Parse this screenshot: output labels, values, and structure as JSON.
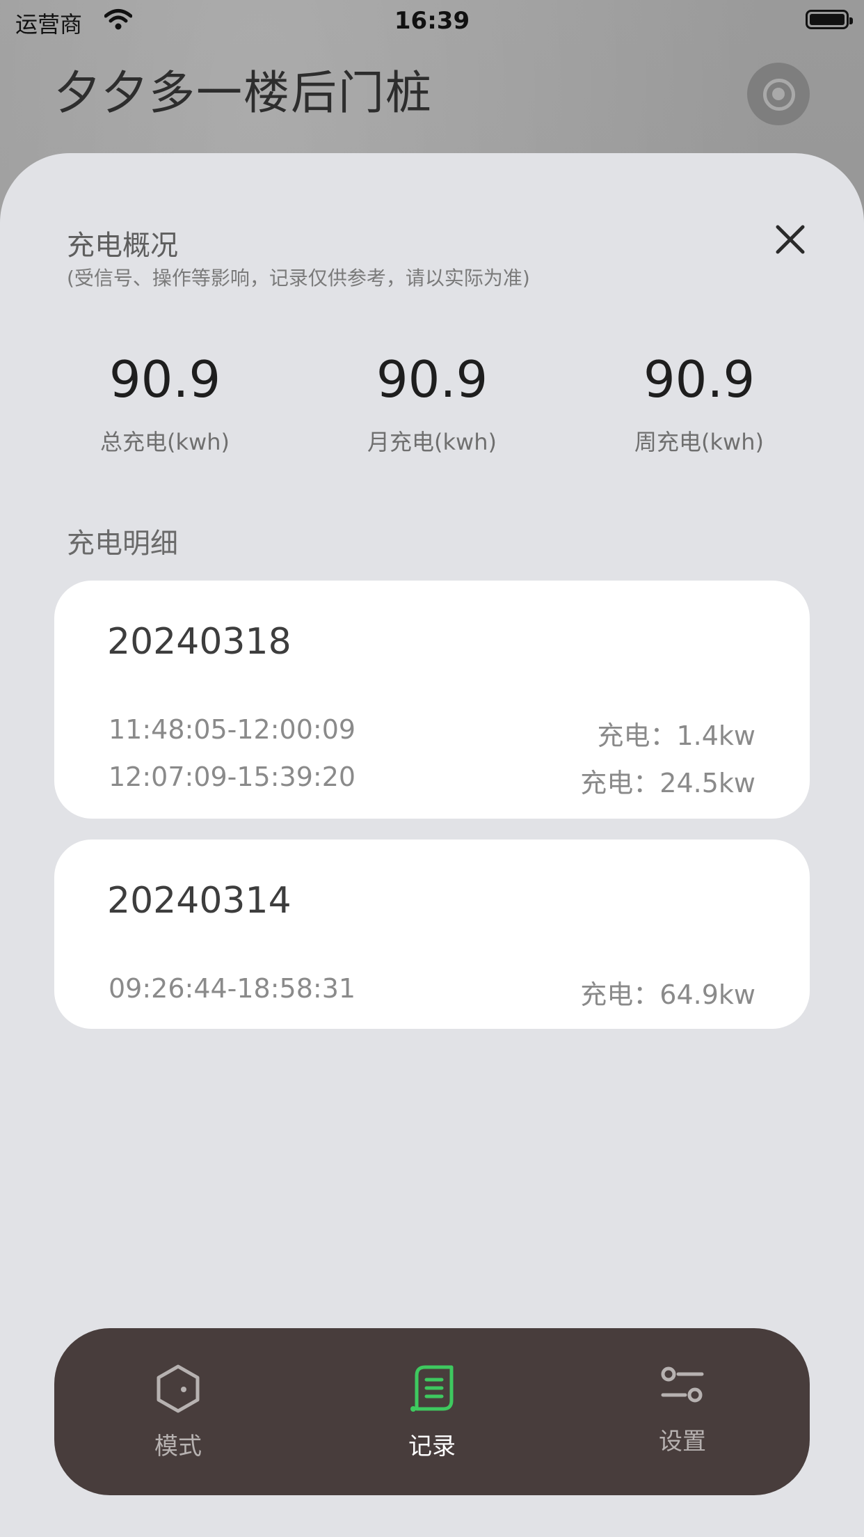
{
  "status_bar": {
    "carrier": "运营商",
    "time": "16:39"
  },
  "header": {
    "title": "夕夕多一楼后门桩"
  },
  "sheet": {
    "title": "充电概况",
    "subtitle": "(受信号、操作等影响，记录仅供参考，请以实际为准)",
    "stats": [
      {
        "value": "90.9",
        "label": "总充电(kwh)"
      },
      {
        "value": "90.9",
        "label": "月充电(kwh)"
      },
      {
        "value": "90.9",
        "label": "周充电(kwh)"
      }
    ],
    "detail_title": "充电明细",
    "cards": [
      {
        "date": "20240318",
        "records": [
          {
            "time": "11:48:05-12:00:09",
            "value": "充电：1.4kw"
          },
          {
            "time": "12:07:09-15:39:20",
            "value": "充电：24.5kw"
          }
        ]
      },
      {
        "date": "20240314",
        "records": [
          {
            "time": "09:26:44-18:58:31",
            "value": "充电：64.9kw"
          }
        ]
      }
    ]
  },
  "tabbar": {
    "active_color": "#3ec95f",
    "items": [
      {
        "label": "模式",
        "icon": "hexagon-mode-icon"
      },
      {
        "label": "记录",
        "icon": "record-list-icon"
      },
      {
        "label": "设置",
        "icon": "settings-sliders-icon"
      }
    ]
  }
}
